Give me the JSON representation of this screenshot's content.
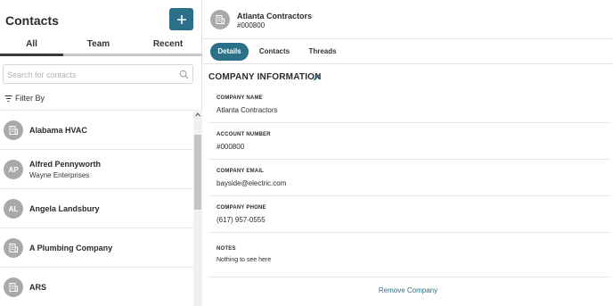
{
  "left_panel": {
    "title": "Contacts",
    "tabs": [
      "All",
      "Team",
      "Recent"
    ],
    "active_tab": "All",
    "search_placeholder": "Search for contacts",
    "filter_label": "Filter By",
    "contacts": [
      {
        "name": "Alabama HVAC",
        "subtitle": "",
        "avatar_type": "building-icon",
        "initials": ""
      },
      {
        "name": "Alfred Pennyworth",
        "subtitle": "Wayne Enterprises",
        "avatar_type": "initials",
        "initials": "AP"
      },
      {
        "name": "Angela Landsbury",
        "subtitle": "",
        "avatar_type": "initials",
        "initials": "AL"
      },
      {
        "name": "A Plumbing Company",
        "subtitle": "",
        "avatar_type": "building-icon",
        "initials": ""
      },
      {
        "name": "ARS",
        "subtitle": "",
        "avatar_type": "building-icon",
        "initials": ""
      }
    ]
  },
  "header": {
    "company_name": "Atlanta Contractors",
    "account_number": "#000800",
    "avatar_icon": "building-icon"
  },
  "detail_tabs": [
    "Details",
    "Contacts",
    "Threads"
  ],
  "active_detail_tab": "Details",
  "company_info": {
    "section_title": "COMPANY INFORMATION",
    "fields": [
      {
        "label": "COMPANY NAME",
        "value": "Atlanta Contractors"
      },
      {
        "label": "ACCOUNT NUMBER",
        "value": "#000800"
      },
      {
        "label": "COMPANY EMAIL",
        "value": "bayside@electric.com"
      },
      {
        "label": "COMPANY PHONE",
        "value": "(617) 957-0555"
      },
      {
        "label": "NOTES",
        "value": "Nothing to see here"
      }
    ],
    "remove_label": "Remove Company"
  },
  "colors": {
    "accent": "#2b6f88",
    "avatar": "#a9a9a9",
    "text": "#2b2b2b"
  }
}
